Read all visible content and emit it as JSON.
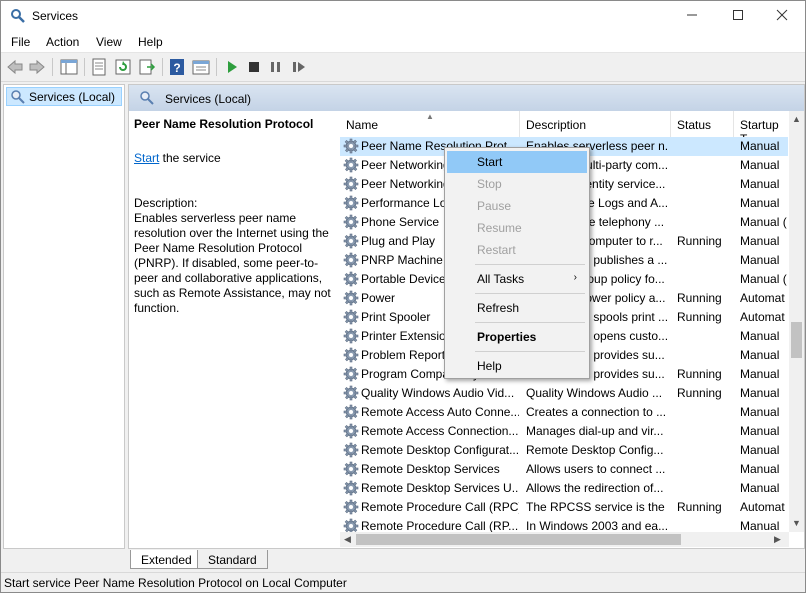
{
  "window": {
    "title": "Services"
  },
  "menu": [
    "File",
    "Action",
    "View",
    "Help"
  ],
  "tree": {
    "root": "Services (Local)"
  },
  "panel": {
    "header": "Services (Local)",
    "service_title": "Peer Name Resolution Protocol",
    "start_link": "Start",
    "start_suffix": " the service",
    "description_label": "Description:",
    "description_text": "Enables serverless peer name resolution over the Internet using the Peer Name Resolution Protocol (PNRP). If disabled, some peer-to-peer and collaborative applications, such as Remote Assistance, may not function."
  },
  "columns": {
    "name": "Name",
    "description": "Description",
    "status": "Status",
    "startup": "Startup T"
  },
  "services": [
    {
      "name": "Peer Name Resolution Prot...",
      "description": "Enables serverless peer n...",
      "status": "",
      "startup": "Manual"
    },
    {
      "name": "Peer Networking Grouping",
      "description": "Provides multi-party com...",
      "status": "",
      "startup": "Manual"
    },
    {
      "name": "Peer Networking Identity M...",
      "description": "Provides identity service...",
      "status": "",
      "startup": "Manual"
    },
    {
      "name": "Performance Logs & Alerts",
      "description": "Performance Logs and A...",
      "status": "",
      "startup": "Manual"
    },
    {
      "name": "Phone Service",
      "description": "Manages the telephony ...",
      "status": "",
      "startup": "Manual ("
    },
    {
      "name": "Plug and Play",
      "description": "Enables a computer to r...",
      "status": "Running",
      "startup": "Manual"
    },
    {
      "name": "PNRP Machine Name Public...",
      "description": "This service publishes a ...",
      "status": "",
      "startup": "Manual"
    },
    {
      "name": "Portable Device Enumerator...",
      "description": "Enforces group policy fo...",
      "status": "",
      "startup": "Manual ("
    },
    {
      "name": "Power",
      "description": "Manages power policy a...",
      "status": "Running",
      "startup": "Automat"
    },
    {
      "name": "Print Spooler",
      "description": "This service spools print ...",
      "status": "Running",
      "startup": "Automat"
    },
    {
      "name": "Printer Extensions and Notif...",
      "description": "This service opens custo...",
      "status": "",
      "startup": "Manual"
    },
    {
      "name": "Problem Reports and Soluti...",
      "description": "This service provides su...",
      "status": "",
      "startup": "Manual"
    },
    {
      "name": "Program Compatibility Assi...",
      "description": "This service provides su...",
      "status": "Running",
      "startup": "Manual"
    },
    {
      "name": "Quality Windows Audio Vid...",
      "description": "Quality Windows Audio ...",
      "status": "Running",
      "startup": "Manual"
    },
    {
      "name": "Remote Access Auto Conne...",
      "description": "Creates a connection to ...",
      "status": "",
      "startup": "Manual"
    },
    {
      "name": "Remote Access Connection...",
      "description": "Manages dial-up and vir...",
      "status": "",
      "startup": "Manual"
    },
    {
      "name": "Remote Desktop Configurat...",
      "description": "Remote Desktop Config...",
      "status": "",
      "startup": "Manual"
    },
    {
      "name": "Remote Desktop Services",
      "description": "Allows users to connect ...",
      "status": "",
      "startup": "Manual"
    },
    {
      "name": "Remote Desktop Services U...",
      "description": "Allows the redirection of...",
      "status": "",
      "startup": "Manual"
    },
    {
      "name": "Remote Procedure Call (RPC)",
      "description": "The RPCSS service is the ...",
      "status": "Running",
      "startup": "Automat"
    },
    {
      "name": "Remote Procedure Call (RP...",
      "description": "In Windows 2003 and ea...",
      "status": "",
      "startup": "Manual"
    }
  ],
  "context_menu": {
    "start": "Start",
    "stop": "Stop",
    "pause": "Pause",
    "resume": "Resume",
    "restart": "Restart",
    "all_tasks": "All Tasks",
    "refresh": "Refresh",
    "properties": "Properties",
    "help": "Help"
  },
  "tabs": [
    "Extended",
    "Standard"
  ],
  "statusbar": {
    "text": "Start service Peer Name Resolution Protocol on Local Computer"
  },
  "colors": {
    "selection": "#cce8ff",
    "menu_highlight": "#91c9f7",
    "link": "#0066cc",
    "header_gradient": "#c4d3e6"
  },
  "icons": [
    "services-app-icon",
    "back-icon",
    "forward-icon",
    "show-tree-icon",
    "properties-icon",
    "refresh-icon",
    "export-icon",
    "help-icon",
    "view-icon",
    "play-icon",
    "stop-icon",
    "pause-icon",
    "restart-icon",
    "gear-icon"
  ]
}
